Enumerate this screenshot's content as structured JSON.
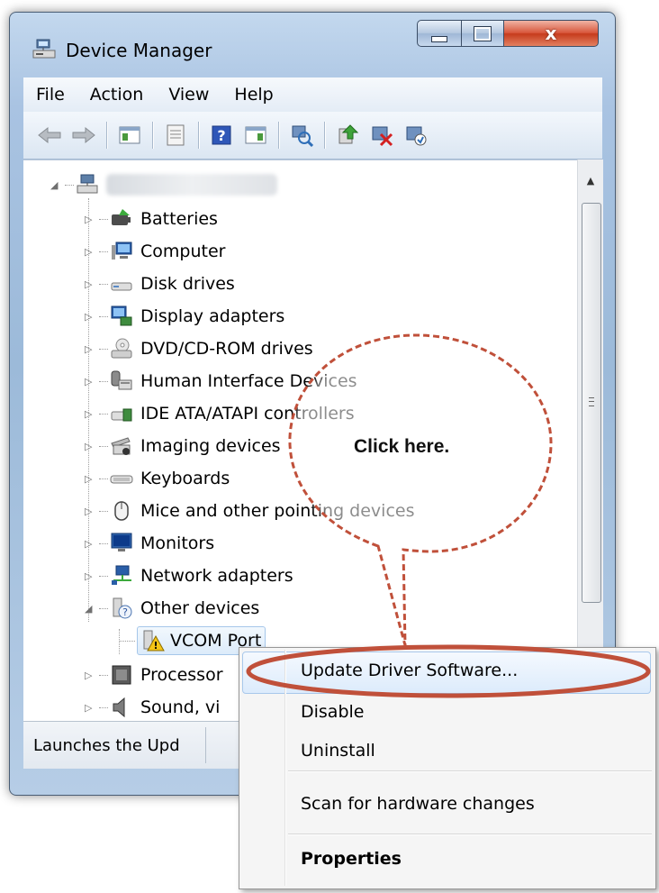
{
  "window": {
    "title": "Device Manager",
    "controls": {
      "close_glyph": "x"
    }
  },
  "menubar": {
    "items": [
      "File",
      "Action",
      "View",
      "Help"
    ]
  },
  "toolbar": {
    "buttons": [
      "back-arrow-icon",
      "forward-arrow-icon",
      "show-hide-console-tree-icon",
      "properties-icon",
      "help-icon",
      "action-pane-icon",
      "scan-hardware-icon",
      "update-driver-icon",
      "uninstall-icon",
      "enable-device-icon"
    ]
  },
  "tree": {
    "computer_name": "",
    "categories": [
      "Batteries",
      "Computer",
      "Disk drives",
      "Display adapters",
      "DVD/CD-ROM drives",
      "Human Interface Devices",
      "IDE ATA/ATAPI controllers",
      "Imaging devices",
      "Keyboards",
      "Mice and other pointing devices",
      "Monitors",
      "Network adapters",
      "Other devices"
    ],
    "selected_device": "VCOM Port",
    "after_categories": [
      "Processor",
      "Sound, vi"
    ]
  },
  "status": {
    "text": "Launches the Upd"
  },
  "context_menu": {
    "items": [
      "Update Driver Software...",
      "Disable",
      "Uninstall",
      "Scan for hardware changes",
      "Properties"
    ],
    "highlighted": "Update Driver Software..."
  },
  "callout": {
    "text": "Click here.",
    "color": "#c0503a"
  },
  "colors": {
    "title_bar": "#a9c3e2",
    "selection": "#dcebfa",
    "close_button": "#c63b1c"
  }
}
